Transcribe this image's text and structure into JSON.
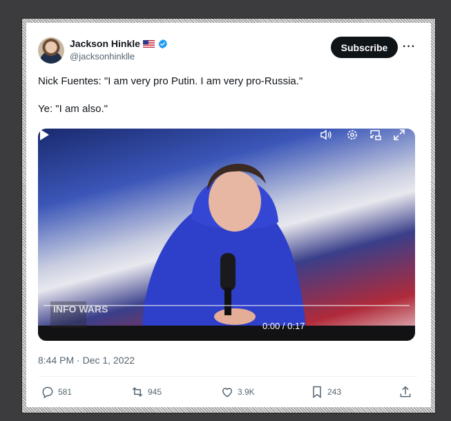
{
  "tweet": {
    "author_name": "Jackson Hinkle",
    "handle": "@jacksonhinklle",
    "subscribe_label": "Subscribe",
    "more_label": "···",
    "text": "Nick Fuentes: \"I am very pro Putin. I am very pro-Russia.\"\n\nYe: \"I am also.\"",
    "timestamp": "8:44 PM · Dec 1, 2022"
  },
  "video": {
    "timecode": "0:00 / 0:17",
    "watermark": "INFO WARS",
    "progress": 0.0
  },
  "actions": {
    "replies": "581",
    "reposts": "945",
    "likes": "3.9K",
    "bookmarks": "243"
  },
  "colors": {
    "accent_blue": "#1d9bf0",
    "text_dark": "#0f1419",
    "text_muted": "#536471"
  }
}
